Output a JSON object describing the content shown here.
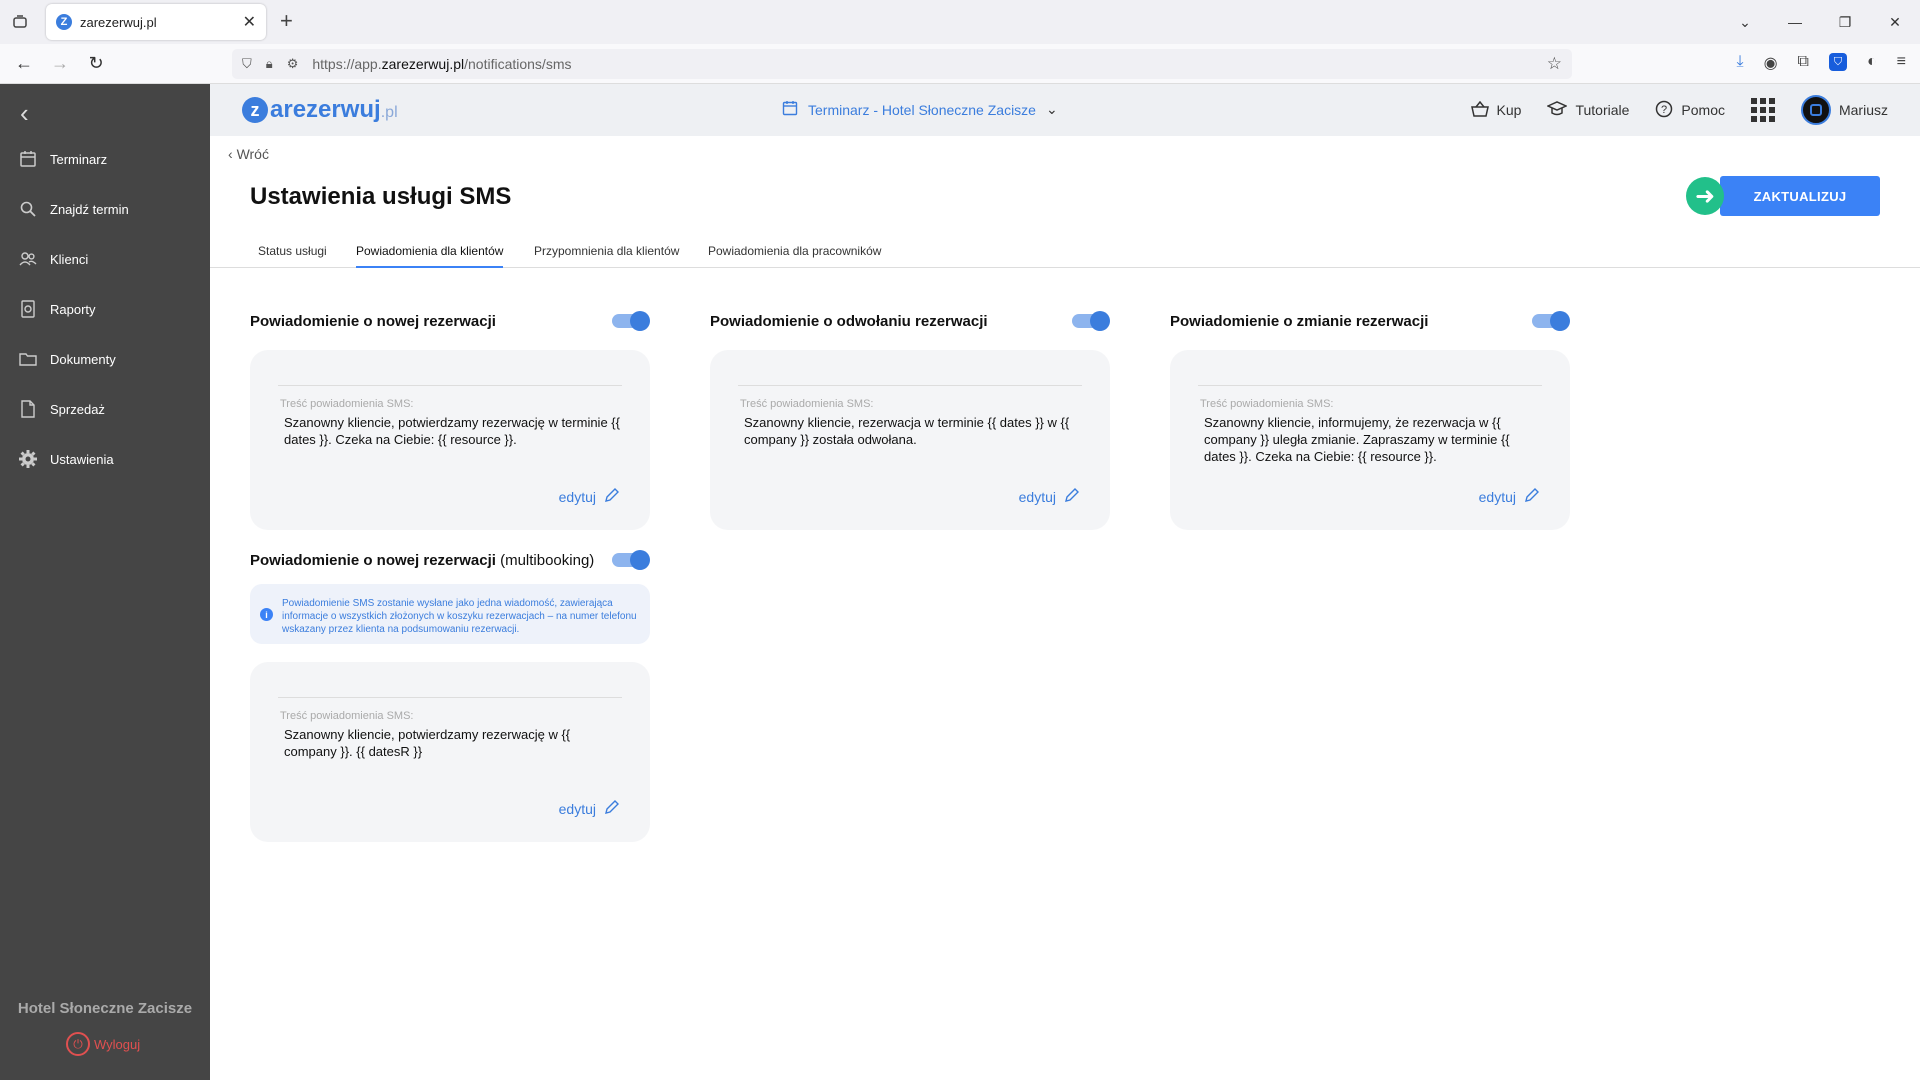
{
  "browser": {
    "tab_title": "zarezerwuj.pl",
    "url_prefix": "https://app.",
    "url_host": "zarezerwuj.pl",
    "url_path": "/notifications/sms"
  },
  "sidebar": {
    "items": [
      {
        "label": "Terminarz",
        "icon": "calendar-icon"
      },
      {
        "label": "Znajdź termin",
        "icon": "search-icon"
      },
      {
        "label": "Klienci",
        "icon": "users-icon"
      },
      {
        "label": "Raporty",
        "icon": "report-icon"
      },
      {
        "label": "Dokumenty",
        "icon": "folder-icon"
      },
      {
        "label": "Sprzedaż",
        "icon": "document-icon"
      },
      {
        "label": "Ustawienia",
        "icon": "gear-icon"
      }
    ],
    "hotel_name": "Hotel Słoneczne Zacisze",
    "logout_label": "Wyloguj"
  },
  "header": {
    "logo_main": "arezerwuj",
    "logo_z": "z",
    "logo_tld": ".pl",
    "calendar_label": "Terminarz - Hotel Słoneczne Zacisze",
    "buy_label": "Kup",
    "tutorials_label": "Tutoriale",
    "help_label": "Pomoc",
    "user_name": "Mariusz"
  },
  "page": {
    "back_label": "Wróć",
    "title": "Ustawienia usługi SMS",
    "update_label": "ZAKTUALIZUJ",
    "tabs": [
      {
        "label": "Status usługi"
      },
      {
        "label": "Powiadomienia dla klientów"
      },
      {
        "label": "Przypomnienia dla klientów"
      },
      {
        "label": "Powiadomienia dla pracowników"
      }
    ]
  },
  "notifications": [
    {
      "title": "Powiadomienie o nowej rezerwacji",
      "enabled": true,
      "content_label": "Treść powiadomienia SMS:",
      "content": "Szanowny kliencie, potwierdzamy rezerwację w terminie {{ dates }}. Czeka na Ciebie: {{ resource }}.",
      "edit_label": "edytuj"
    },
    {
      "title": "Powiadomienie o odwołaniu rezerwacji",
      "enabled": true,
      "content_label": "Treść powiadomienia SMS:",
      "content": "Szanowny kliencie, rezerwacja w terminie {{ dates }} w {{ company }} została odwołana.",
      "edit_label": "edytuj"
    },
    {
      "title": "Powiadomienie o zmianie rezerwacji",
      "enabled": true,
      "content_label": "Treść powiadomienia SMS:",
      "content": "Szanowny kliencie, informujemy, że rezerwacja w {{ company }} uległa zmianie. Zapraszamy w terminie {{ dates }}. Czeka na Ciebie: {{ resource }}.",
      "edit_label": "edytuj"
    },
    {
      "title": "Powiadomienie o nowej rezerwacji",
      "title_suffix": "(multibooking)",
      "enabled": true,
      "info": "Powiadomienie SMS zostanie wysłane jako jedna wiadomość, zawierająca informacje o wszystkich złożonych w koszyku rezerwacjach – na numer telefonu wskazany przez klienta na podsumowaniu rezerwacji.",
      "content_label": "Treść powiadomienia SMS:",
      "content": "Szanowny kliencie, potwierdzamy rezerwację w {{ company }}. {{ datesR }}",
      "edit_label": "edytuj"
    }
  ],
  "colors": {
    "accent": "#3b7ddd",
    "sidebar": "#454545",
    "update_arrow": "#22c08a"
  }
}
